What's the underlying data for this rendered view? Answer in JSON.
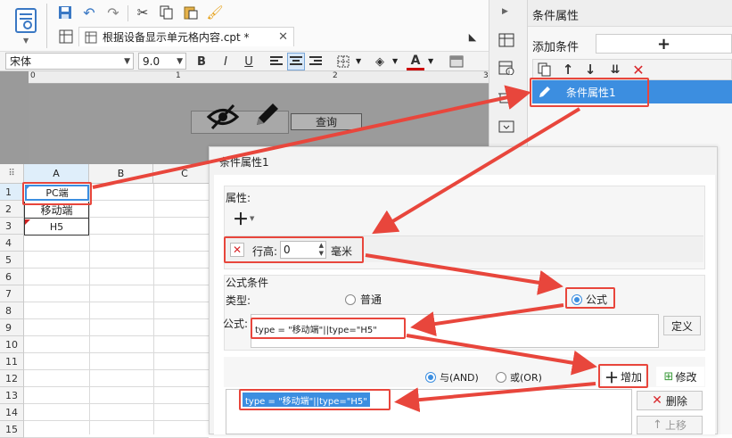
{
  "tab": {
    "title": "根据设备显示单元格内容.cpt *"
  },
  "format": {
    "font": "宋体",
    "size": "9.0",
    "bold": "B",
    "italic": "I",
    "underline": "U"
  },
  "preview": {
    "query_button": "查询"
  },
  "sheet": {
    "columns": [
      "A",
      "B",
      "C"
    ],
    "rows": [
      "1",
      "2",
      "3",
      "4",
      "5",
      "6",
      "7",
      "8",
      "9",
      "10",
      "11",
      "12",
      "13",
      "14",
      "15"
    ],
    "cells": {
      "a1": "PC端",
      "a2": "移动端",
      "a3": "H5"
    }
  },
  "cond_panel": {
    "title": "条件属性",
    "add_label": "添加条件",
    "add_button": "+",
    "item": "条件属性1"
  },
  "dialog": {
    "title": "条件属性1",
    "attr_label": "属性:",
    "row_height_label": "行高:",
    "row_height_value": "0",
    "unit": "毫米",
    "formula_group": "公式条件",
    "type_label": "类型:",
    "opt_normal": "普通",
    "opt_formula": "公式",
    "formula_label": "公式:",
    "formula_text": "type = \"移动端\"||type=\"H5\"",
    "define_button": "定义",
    "and_label": "与(AND)",
    "or_label": "或(OR)",
    "add_button": "增加",
    "modify_button": "修改",
    "delete_button": "删除",
    "up_button": "上移",
    "result_text": "type = \"移动端\"||type=\"H5\""
  },
  "colors": {
    "accent": "#3c8ee0",
    "annotation": "#e8463c"
  }
}
